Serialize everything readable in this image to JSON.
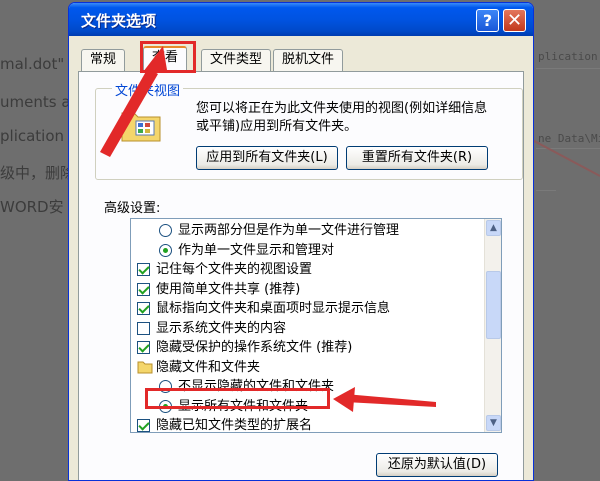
{
  "background": {
    "fragments": [
      "mal.dot\"",
      "uments a",
      "plication",
      "级中，删除",
      "WORD安"
    ],
    "right_fragments": [
      "plication",
      "ne Data\\Mic"
    ]
  },
  "dialog": {
    "title": "文件夹选项",
    "help_glyph": "?",
    "close_glyph": "✕"
  },
  "tabs": [
    {
      "label": "常规"
    },
    {
      "label": "查看",
      "active": true
    },
    {
      "label": "文件类型"
    },
    {
      "label": "脱机文件"
    }
  ],
  "folder_views": {
    "group_label": "文件夹视图",
    "description": "您可以将正在为此文件夹使用的视图(例如详细信息或平铺)应用到所有文件夹。",
    "apply_button": "应用到所有文件夹(L)",
    "reset_button": "重置所有文件夹(R)"
  },
  "advanced": {
    "label": "高级设置:",
    "items": [
      {
        "type": "radio",
        "checked": false,
        "indent": 1,
        "label": "显示两部分但是作为单一文件进行管理"
      },
      {
        "type": "radio",
        "checked": true,
        "indent": 1,
        "label": "作为单一文件显示和管理对"
      },
      {
        "type": "checkbox",
        "checked": true,
        "indent": 0,
        "label": "记住每个文件夹的视图设置"
      },
      {
        "type": "checkbox",
        "checked": true,
        "indent": 0,
        "label": "使用简单文件共享 (推荐)"
      },
      {
        "type": "checkbox",
        "checked": true,
        "indent": 0,
        "label": "鼠标指向文件夹和桌面项时显示提示信息"
      },
      {
        "type": "checkbox",
        "checked": false,
        "indent": 0,
        "label": "显示系统文件夹的内容"
      },
      {
        "type": "checkbox",
        "checked": true,
        "indent": 0,
        "label": "隐藏受保护的操作系统文件 (推荐)"
      },
      {
        "type": "folder",
        "indent": 0,
        "label": "隐藏文件和文件夹"
      },
      {
        "type": "radio",
        "checked": false,
        "indent": 1,
        "label": "不显示隐藏的文件和文件夹"
      },
      {
        "type": "radio",
        "checked": true,
        "indent": 1,
        "label": "显示所有文件和文件夹"
      },
      {
        "type": "checkbox",
        "checked": true,
        "indent": 0,
        "label": "隐藏已知文件类型的扩展名"
      }
    ],
    "restore_button": "还原为默认值(D)"
  },
  "colors": {
    "annotation_red": "#e22929",
    "titlebar_blue": "#0053e1",
    "dialog_face": "#ece9d8"
  },
  "icons": [
    "folder-options-icon",
    "help-icon",
    "close-icon",
    "scroll-up-icon",
    "scroll-down-icon",
    "folder-icon"
  ]
}
